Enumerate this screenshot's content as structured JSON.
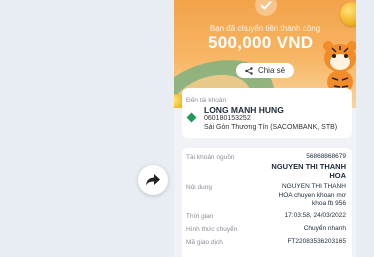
{
  "hero": {
    "status_message": "Bạn đã chuyển tiền thành công",
    "amount": "500,000 VND",
    "share_label": "Chia sẻ"
  },
  "recipient": {
    "label": "Đến tài khoản",
    "name": "LONG MANH HUNG",
    "account_number": "060180153252",
    "bank": "Sài Gòn Thương Tín (SACOMBANK, STB)"
  },
  "details": {
    "source_account_label": "Tài khoản nguồn",
    "source_account_number": "56868868679",
    "source_account_name_1": "NGUYEN THI THANH",
    "source_account_name_2": "HOA",
    "content_label": "Nội dung",
    "content_line_1": "NGUYEN THI THANH",
    "content_line_2": "HOA chuyen khoan mơ",
    "content_line_3": "khoa fb 956",
    "time_label": "Thời gian",
    "time_value": "17:03:58, 24/03/2022",
    "method_label": "Hình thức chuyển",
    "method_value": "Chuyển nhanh",
    "txn_label": "Mã giao dịch",
    "txn_value": "FT22083536203165"
  },
  "colors": {
    "hero_orange": "#f3a24a",
    "title_navy": "#1b2a3a",
    "label_grey": "#8a8f98"
  }
}
